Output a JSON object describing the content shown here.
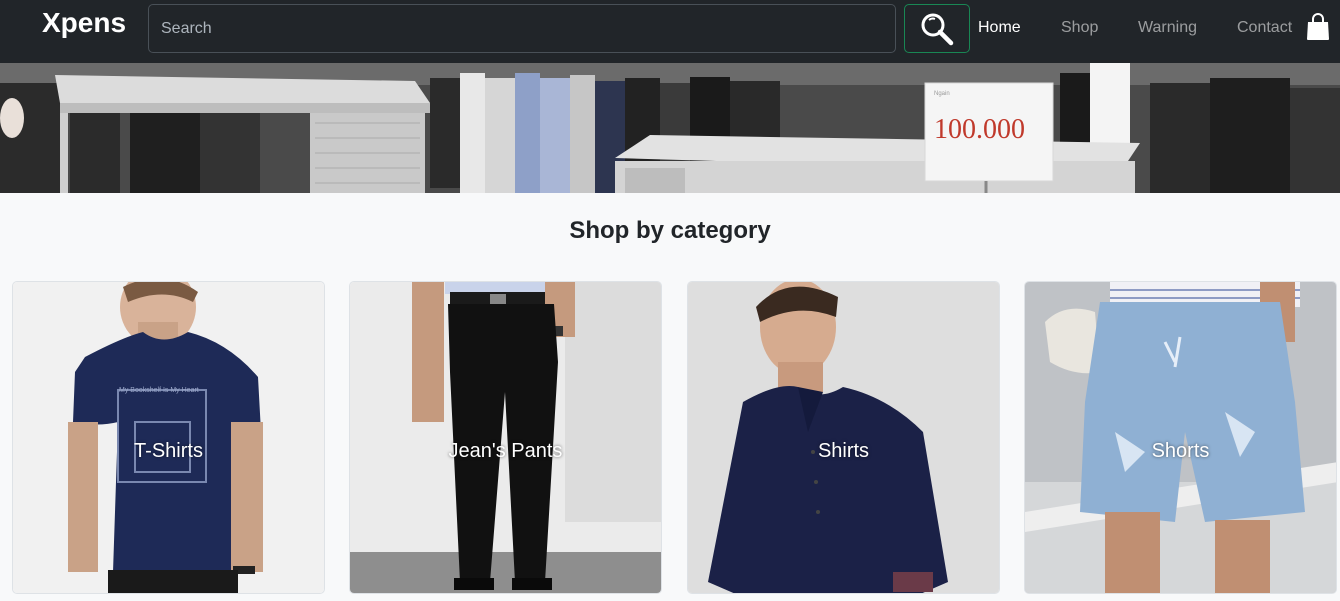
{
  "navbar": {
    "brand": "Xpens",
    "search_placeholder": "Search",
    "links": [
      {
        "label": "Home",
        "active": true
      },
      {
        "label": "Shop",
        "active": false
      },
      {
        "label": "Warning",
        "active": false
      },
      {
        "label": "Contact",
        "active": false
      }
    ]
  },
  "banner": {
    "price_tag": "100.000"
  },
  "main": {
    "title": "Shop by category",
    "categories": [
      {
        "label": "T-Shirts"
      },
      {
        "label": "Jean's Pants"
      },
      {
        "label": "Shirts"
      },
      {
        "label": "Shorts"
      }
    ]
  },
  "colors": {
    "navbar_bg": "#212529",
    "search_button_border": "#198754",
    "page_bg": "#f8f9fa"
  },
  "icons": [
    "search-icon",
    "shopping-bag-icon"
  ]
}
